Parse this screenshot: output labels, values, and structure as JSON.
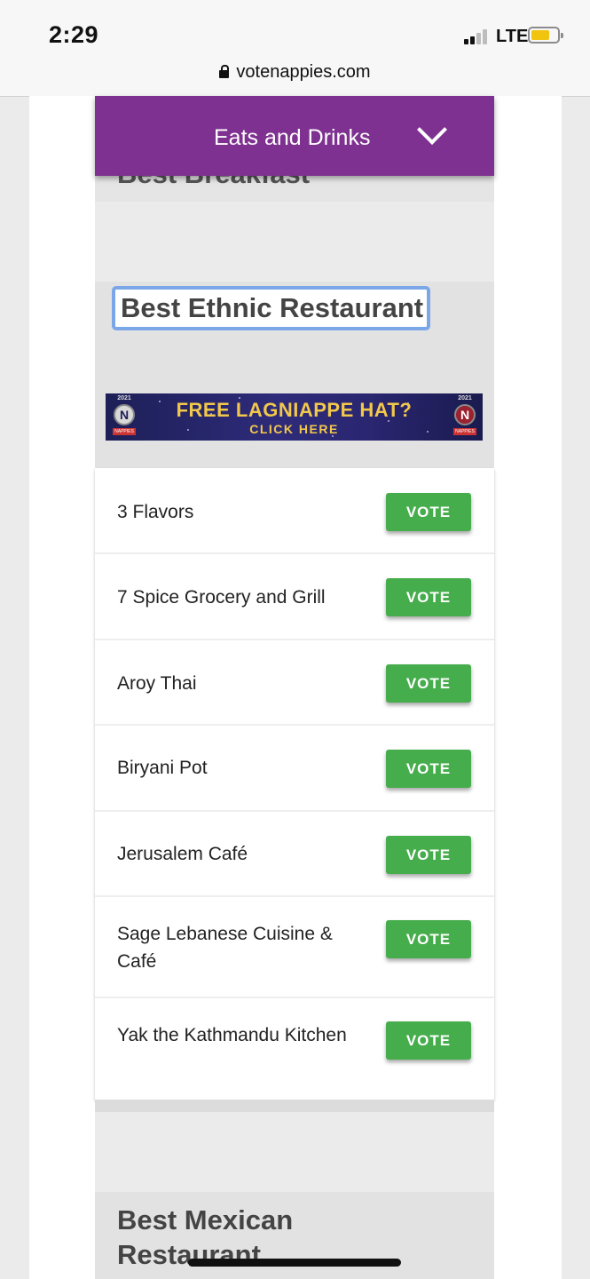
{
  "status_bar": {
    "time": "2:29",
    "network": "LTE"
  },
  "browser": {
    "url": "votenappies.com"
  },
  "category_dropdown": {
    "selected": "Eats and Drinks"
  },
  "previous_section": {
    "title": "Best Breakfast"
  },
  "section": {
    "title": "Best Ethnic Restaurant",
    "promo_banner": {
      "headline": "FREE LAGNIAPPE HAT?",
      "subline": "CLICK HERE",
      "badge_year": "2021",
      "badge_letter": "N",
      "badge_caption": "NAPPIES"
    },
    "vote_label": "VOTE",
    "nominees": [
      "3 Flavors",
      "7 Spice Grocery and Grill",
      "Aroy Thai",
      "Biryani Pot",
      "Jerusalem Café",
      "Sage Lebanese Cuisine & Café",
      "Yak the Kathmandu Kitchen"
    ]
  },
  "next_section": {
    "title": "Best Mexican Restaurant"
  },
  "colors": {
    "brand_purple": "#7e3190",
    "vote_green": "#46ad4c",
    "promo_gold": "#f2c84b",
    "focus_outline": "#7ba7e8",
    "battery": "#f1c40f"
  },
  "icons": [
    "lock-icon",
    "signal-icon",
    "battery-icon",
    "chevron-down-icon",
    "nappies-badge-icon"
  ]
}
